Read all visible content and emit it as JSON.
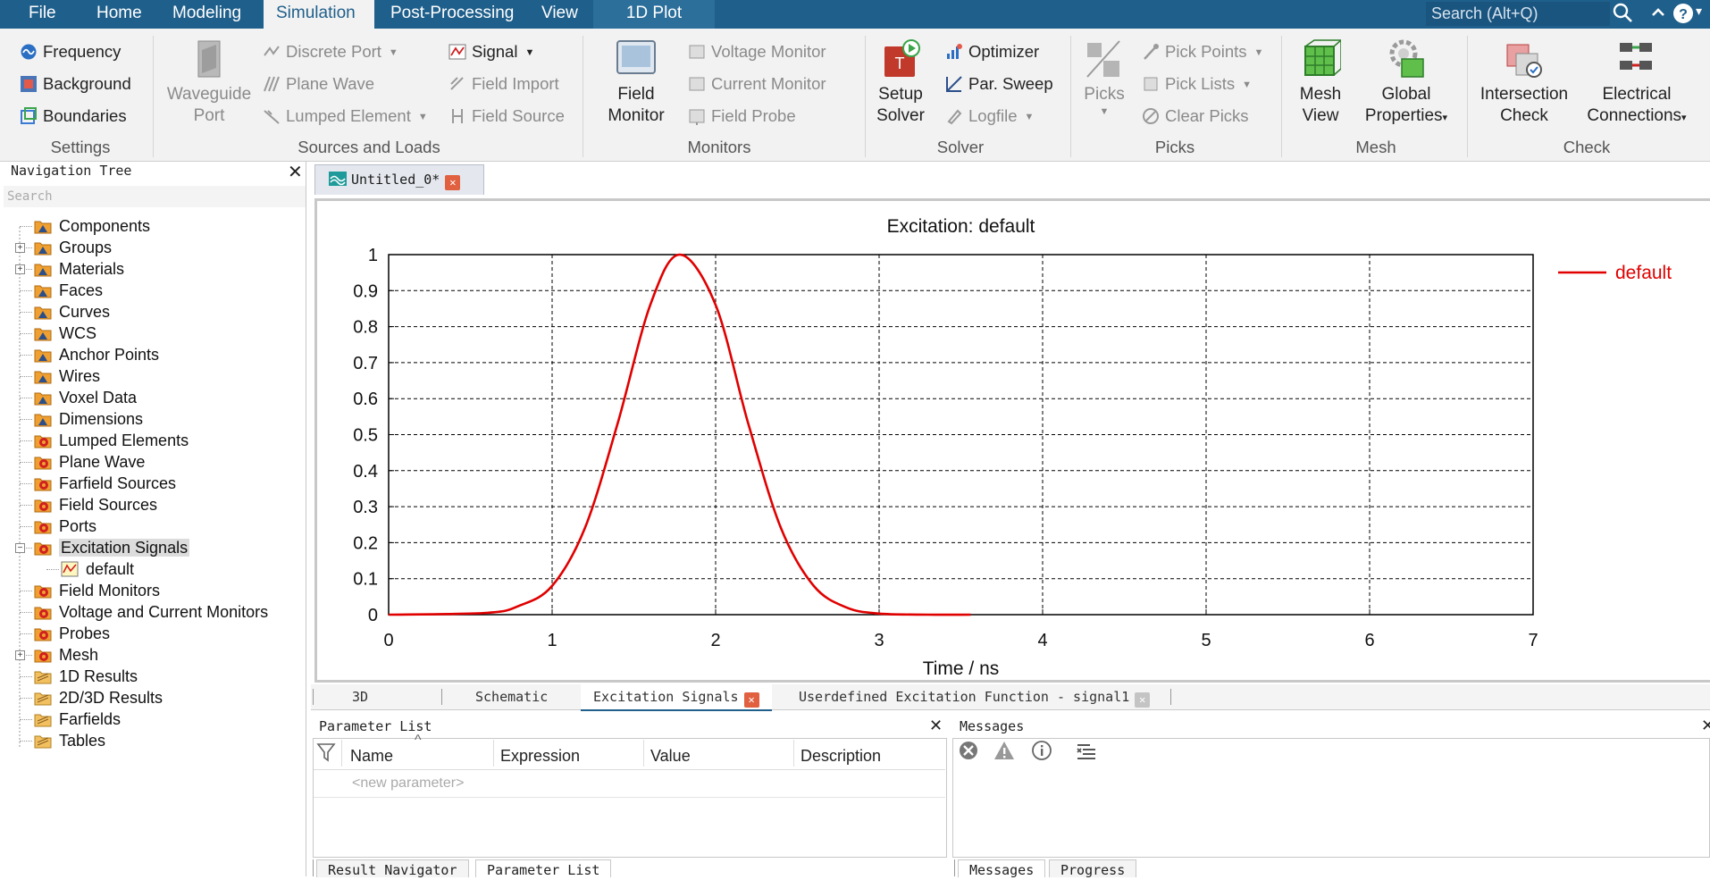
{
  "menubar": {
    "items": [
      "File",
      "Home",
      "Modeling",
      "Simulation",
      "Post-Processing",
      "View",
      "1D Plot"
    ],
    "search_placeholder": "Search (Alt+Q)"
  },
  "ribbon": {
    "settings": {
      "frequency": "Frequency",
      "background": "Background",
      "boundaries": "Boundaries",
      "label": "Settings"
    },
    "sources": {
      "waveguide_port_1": "Waveguide",
      "waveguide_port_2": "Port",
      "discrete_port": "Discrete Port",
      "plane_wave": "Plane Wave",
      "lumped_element": "Lumped Element",
      "signal": "Signal",
      "field_import": "Field Import",
      "field_source": "Field Source",
      "label": "Sources and Loads"
    },
    "monitors": {
      "field_monitor_1": "Field",
      "field_monitor_2": "Monitor",
      "voltage_monitor": "Voltage Monitor",
      "current_monitor": "Current Monitor",
      "field_probe": "Field Probe",
      "label": "Monitors"
    },
    "solver": {
      "setup_1": "Setup",
      "setup_2": "Solver",
      "optimizer": "Optimizer",
      "par_sweep": "Par. Sweep",
      "logfile": "Logfile",
      "label": "Solver"
    },
    "picks": {
      "picks": "Picks",
      "pick_points": "Pick Points",
      "pick_lists": "Pick Lists",
      "clear_picks": "Clear Picks",
      "label": "Picks"
    },
    "mesh": {
      "mesh_view_1": "Mesh",
      "mesh_view_2": "View",
      "global_1": "Global",
      "global_2": "Properties",
      "label": "Mesh"
    },
    "check": {
      "intersection_1": "Intersection",
      "intersection_2": "Check",
      "electrical_1": "Electrical",
      "electrical_2": "Connections",
      "label": "Check"
    }
  },
  "nav": {
    "title": "Navigation Tree",
    "search_placeholder": "Search",
    "items": [
      "Components",
      "Groups",
      "Materials",
      "Faces",
      "Curves",
      "WCS",
      "Anchor Points",
      "Wires",
      "Voxel Data",
      "Dimensions",
      "Lumped Elements",
      "Plane Wave",
      "Farfield Sources",
      "Field Sources",
      "Ports",
      "Excitation Signals",
      "default",
      "Field Monitors",
      "Voltage and Current Monitors",
      "Probes",
      "Mesh",
      "1D Results",
      "2D/3D Results",
      "Farfields",
      "Tables"
    ]
  },
  "doc_tab": "Untitled_0*",
  "view_tabs": [
    "3D",
    "Schematic",
    "Excitation Signals",
    "Userdefined Excitation Function - signal1"
  ],
  "param_list": {
    "title": "Parameter List",
    "columns": [
      "Name",
      "Expression",
      "Value",
      "Description"
    ],
    "new_param": "<new parameter>"
  },
  "messages": {
    "title": "Messages"
  },
  "bottom_tabs": [
    "Result Navigator",
    "Parameter List",
    "Messages",
    "Progress"
  ],
  "colors": {
    "accent": "#1f5f8b",
    "series": "#e00000"
  },
  "chart_data": {
    "type": "line",
    "title": "Excitation: default",
    "xlabel": "Time / ns",
    "ylabel": "",
    "xlim": [
      0,
      7
    ],
    "ylim": [
      0,
      1
    ],
    "xticks": [
      "0",
      "1",
      "2",
      "3",
      "4",
      "5",
      "6",
      "7"
    ],
    "yticks": [
      "0",
      "0.1",
      "0.2",
      "0.3",
      "0.4",
      "0.5",
      "0.6",
      "0.7",
      "0.8",
      "0.9",
      "1"
    ],
    "grid": true,
    "legend": "top-right",
    "series": [
      {
        "name": "default",
        "x": [
          0,
          0.6,
          0.8,
          1.0,
          1.2,
          1.4,
          1.6,
          1.78,
          2.0,
          2.2,
          2.4,
          2.6,
          2.8,
          3.0,
          3.3,
          3.56
        ],
        "y": [
          0,
          0.005,
          0.025,
          0.08,
          0.24,
          0.53,
          0.86,
          1.0,
          0.86,
          0.53,
          0.24,
          0.08,
          0.02,
          0.003,
          0.0,
          0.0
        ]
      }
    ]
  }
}
